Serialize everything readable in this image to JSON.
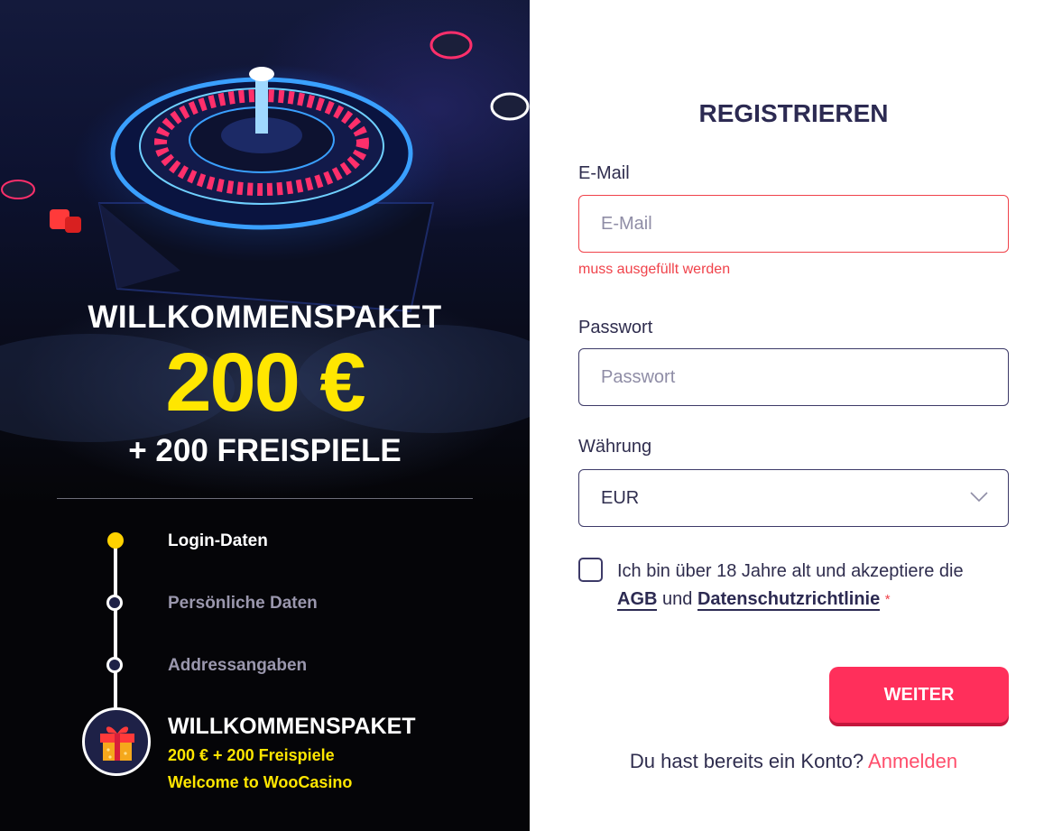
{
  "promo": {
    "title": "WILLKOMMENSPAKET",
    "amount": "200 €",
    "spins": "+ 200 FREISPIELE"
  },
  "steps": [
    {
      "label": "Login-Daten",
      "state": "active"
    },
    {
      "label": "Persönliche Daten",
      "state": "idle"
    },
    {
      "label": "Addressangaben",
      "state": "idle"
    }
  ],
  "bonus": {
    "title": "WILLKOMMENSPAKET",
    "line1": "200 € + 200 Freispiele",
    "line2": "Welcome to WooCasino",
    "icon": "gift-icon"
  },
  "form": {
    "title": "REGISTRIEREN",
    "email": {
      "label": "E-Mail",
      "placeholder": "E-Mail",
      "value": "",
      "error": "muss ausgefüllt werden"
    },
    "password": {
      "label": "Passwort",
      "placeholder": "Passwort",
      "value": ""
    },
    "currency": {
      "label": "Währung",
      "value": "EUR"
    },
    "terms": {
      "text_before": "Ich bin über 18 Jahre alt und akzeptiere die",
      "agb": "AGB",
      "und": "und",
      "privacy": "Datenschutzrichtlinie",
      "required_mark": "*",
      "checked": false
    },
    "submit_label": "WEITER",
    "login_prompt": "Du hast bereits ein Konto?",
    "login_link": "Anmelden"
  },
  "colors": {
    "accent": "#ff2f5b",
    "error": "#f0424a",
    "promo_yellow": "#ffe600",
    "text_dark": "#2c2a52"
  }
}
